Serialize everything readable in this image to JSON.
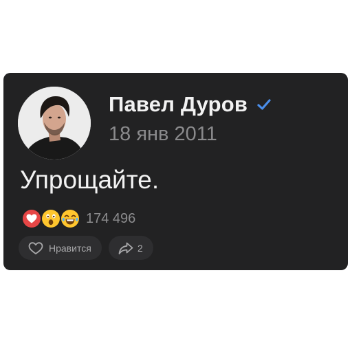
{
  "post": {
    "author_name": "Павел Дуров",
    "verified": true,
    "date": "18 янв 2011",
    "text": "Упрощайте.",
    "reactions": {
      "emojis": [
        "heart-reaction",
        "wow-reaction",
        "laugh-reaction"
      ],
      "count": "174 496"
    },
    "actions": {
      "like_label": "Нравится",
      "share_count": "2"
    }
  },
  "colors": {
    "card_background": "#222223",
    "verified": "#4a8eea",
    "heart": "#e64646",
    "emoji_yellow": "#ffc62e"
  }
}
